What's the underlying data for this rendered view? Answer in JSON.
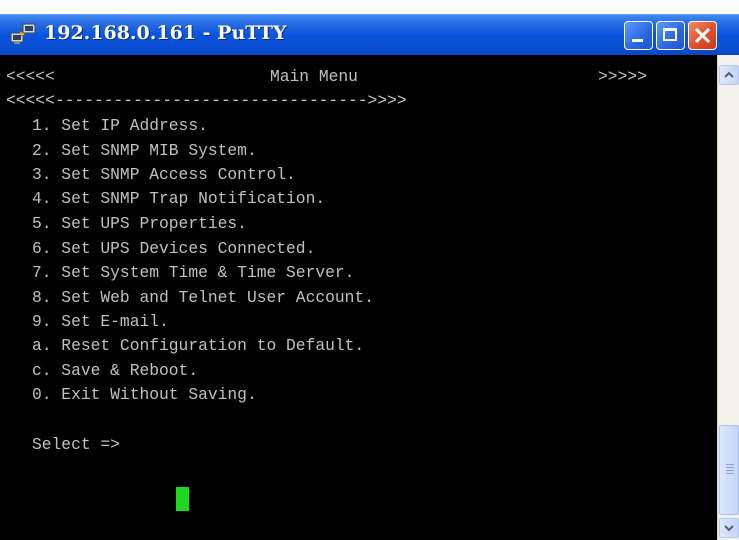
{
  "window": {
    "title": "192.168.0.161 - PuTTY",
    "icons": {
      "app": "putty-network-icon",
      "minimize": "minimize-icon",
      "maximize": "maximize-icon",
      "close": "close-icon",
      "scroll_up": "scroll-up-arrow-icon",
      "scroll_down": "scroll-down-arrow-icon"
    }
  },
  "terminal": {
    "header_left": "<<<<<",
    "header_title": "Main Menu",
    "header_right": ">>>>>",
    "separator": "<<<<<-------------------------------->>>>",
    "menu_items": [
      "1. Set IP Address.",
      "2. Set SNMP MIB System.",
      "3. Set SNMP Access Control.",
      "4. Set SNMP Trap Notification.",
      "5. Set UPS Properties.",
      "6. Set UPS Devices Connected.",
      "7. Set System Time & Time Server.",
      "8. Set Web and Telnet User Account.",
      "9. Set E-mail.",
      "a. Reset Configuration to Default.",
      "c. Save & Reboot.",
      "0. Exit Without Saving."
    ],
    "prompt": "Select =>"
  },
  "colors": {
    "titlebar": "#0a54de",
    "terminal_bg": "#000000",
    "terminal_text": "#c0c0c0",
    "cursor": "#1ed81e",
    "close_button": "#e0502a"
  }
}
